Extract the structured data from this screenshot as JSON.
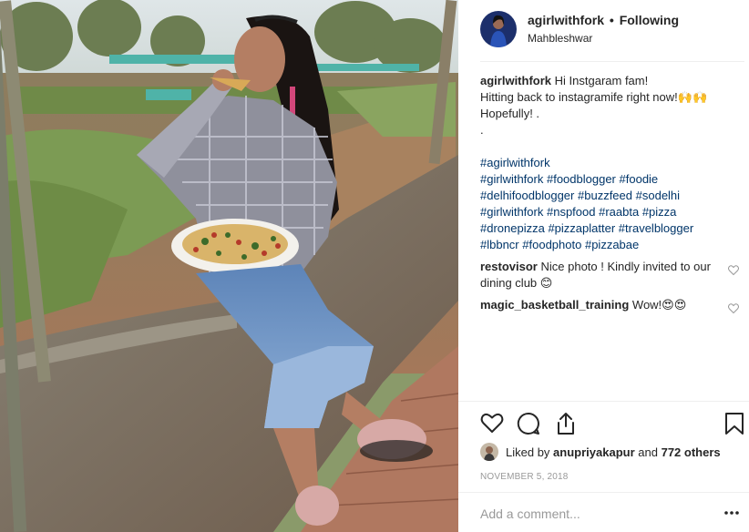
{
  "header": {
    "username": "agirlwithfork",
    "separator": "•",
    "follow_status": "Following",
    "location": "Mahbleshwar"
  },
  "caption": {
    "username": "agirlwithfork",
    "text": "Hi Instgaram fam!\nHitting back to instagramife right now!🙌🙌\nHopefully! .\n."
  },
  "hashtags": [
    "#agirlwithfork",
    "#girlwithfork",
    "#foodblogger",
    "#foodie",
    "#delhifoodblogger",
    "#buzzfeed",
    "#sodelhi",
    "#girlwithfork",
    "#nspfood",
    "#raabta",
    "#pizza",
    "#dronepizza",
    "#pizzaplatter",
    "#travelblogger",
    "#lbbncr",
    "#foodphoto",
    "#pizzabae"
  ],
  "comments": [
    {
      "username": "restovisor",
      "text": "Nice photo ! Kindly invited to our dining club 😊"
    },
    {
      "username": "magic_basketball_training",
      "text": "Wow!😍😍"
    }
  ],
  "likes": {
    "prefix": "Liked by",
    "user": "anupriyakapur",
    "middle": "and",
    "count_text": "772 others"
  },
  "date": "NOVEMBER 5, 2018",
  "add_comment": {
    "placeholder": "Add a comment..."
  },
  "icons": {
    "like": "heart-icon",
    "comment": "comment-icon",
    "share": "share-icon",
    "save": "bookmark-icon",
    "more": "more-icon"
  },
  "colors": {
    "text": "#262626",
    "hashtag": "#003569",
    "muted": "#999999",
    "divider": "#efefef"
  }
}
